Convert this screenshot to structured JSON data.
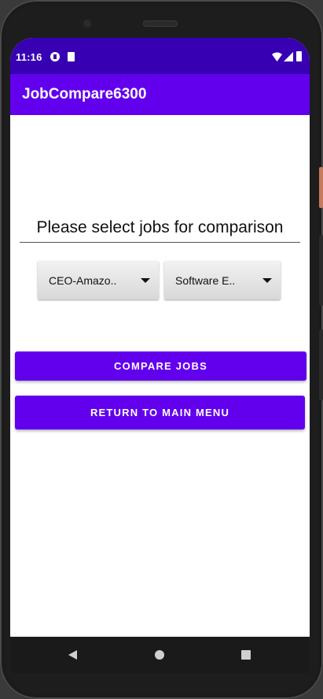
{
  "status": {
    "time": "11:16"
  },
  "appbar": {
    "title": "JobCompare6300"
  },
  "content": {
    "prompt": "Please select jobs for comparison",
    "spinner1_value": "CEO-Amazo..",
    "spinner2_value": "Software E..",
    "compare_label": "COMPARE JOBS",
    "return_label": "RETURN TO MAIN MENU"
  },
  "colors": {
    "status_bar": "#3700b3",
    "app_bar": "#6200ee",
    "button": "#6200ee"
  },
  "icons": [
    "wifi-icon",
    "signal-icon",
    "battery-icon",
    "back-icon",
    "home-icon",
    "recents-icon"
  ]
}
